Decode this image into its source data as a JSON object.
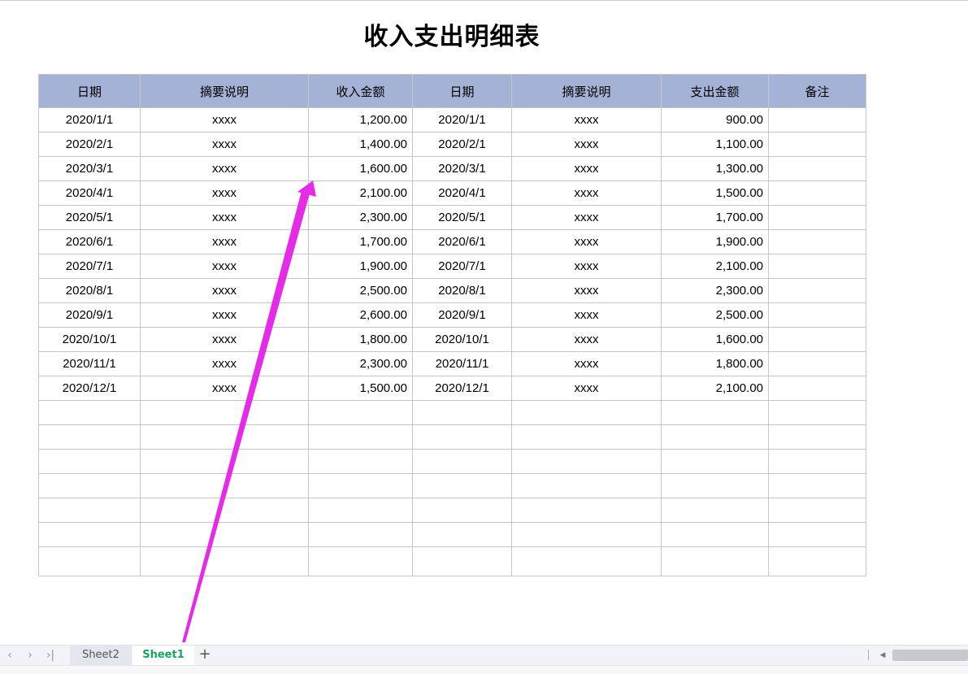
{
  "sheet": {
    "title": "收入支出明细表",
    "headers": [
      "日期",
      "摘要说明",
      "收入金额",
      "日期",
      "摘要说明",
      "支出金额",
      "备注"
    ],
    "rows": [
      [
        "2020/1/1",
        "xxxx",
        "1,200.00",
        "2020/1/1",
        "xxxx",
        "900.00",
        ""
      ],
      [
        "2020/2/1",
        "xxxx",
        "1,400.00",
        "2020/2/1",
        "xxxx",
        "1,100.00",
        ""
      ],
      [
        "2020/3/1",
        "xxxx",
        "1,600.00",
        "2020/3/1",
        "xxxx",
        "1,300.00",
        ""
      ],
      [
        "2020/4/1",
        "xxxx",
        "2,100.00",
        "2020/4/1",
        "xxxx",
        "1,500.00",
        ""
      ],
      [
        "2020/5/1",
        "xxxx",
        "2,300.00",
        "2020/5/1",
        "xxxx",
        "1,700.00",
        ""
      ],
      [
        "2020/6/1",
        "xxxx",
        "1,700.00",
        "2020/6/1",
        "xxxx",
        "1,900.00",
        ""
      ],
      [
        "2020/7/1",
        "xxxx",
        "1,900.00",
        "2020/7/1",
        "xxxx",
        "2,100.00",
        ""
      ],
      [
        "2020/8/1",
        "xxxx",
        "2,500.00",
        "2020/8/1",
        "xxxx",
        "2,300.00",
        ""
      ],
      [
        "2020/9/1",
        "xxxx",
        "2,600.00",
        "2020/9/1",
        "xxxx",
        "2,500.00",
        ""
      ],
      [
        "2020/10/1",
        "xxxx",
        "1,800.00",
        "2020/10/1",
        "xxxx",
        "1,600.00",
        ""
      ],
      [
        "2020/11/1",
        "xxxx",
        "2,300.00",
        "2020/11/1",
        "xxxx",
        "1,800.00",
        ""
      ],
      [
        "2020/12/1",
        "xxxx",
        "1,500.00",
        "2020/12/1",
        "xxxx",
        "2,100.00",
        ""
      ]
    ],
    "empty_rows": 7,
    "header_color": "#a4b2d5"
  },
  "annotation": {
    "arrow_color": "#e52ae8"
  },
  "tabbar": {
    "nav_icons": [
      "chevron-left-icon",
      "chevron-right-icon",
      "skip-last-icon"
    ],
    "tabs": [
      {
        "label": "Sheet2",
        "active": false
      },
      {
        "label": "Sheet1",
        "active": true
      }
    ],
    "add_tab_icon": "plus-icon",
    "active_tab_color": "#1aa260"
  }
}
